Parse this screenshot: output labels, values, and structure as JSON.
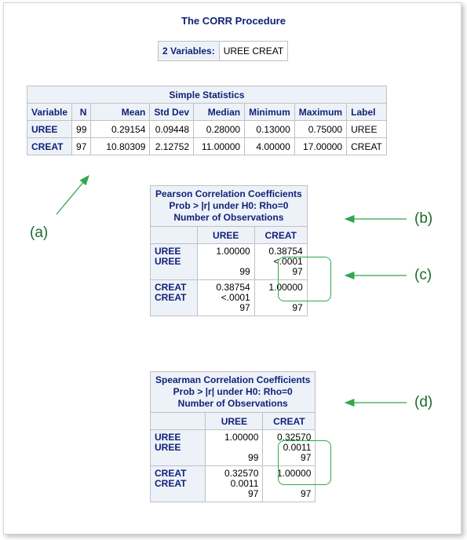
{
  "title": "The CORR Procedure",
  "variables_box": {
    "label": "2 Variables:",
    "value": "UREE CREAT"
  },
  "simple_stats": {
    "caption": "Simple Statistics",
    "headers": [
      "Variable",
      "N",
      "Mean",
      "Std Dev",
      "Median",
      "Minimum",
      "Maximum",
      "Label"
    ],
    "rows": [
      [
        "UREE",
        "99",
        "0.29154",
        "0.09448",
        "0.28000",
        "0.13000",
        "0.75000",
        "UREE"
      ],
      [
        "CREAT",
        "97",
        "10.80309",
        "2.12752",
        "11.00000",
        "4.00000",
        "17.00000",
        "CREAT"
      ]
    ]
  },
  "pearson": {
    "caption": [
      "Pearson Correlation Coefficients",
      "Prob > |r| under H0: Rho=0",
      "Number of Observations"
    ],
    "col_headers": [
      "UREE",
      "CREAT"
    ],
    "rows": [
      {
        "name": "UREE",
        "label": "UREE",
        "c1": [
          "1.00000",
          "",
          "99"
        ],
        "c2": [
          "0.38754",
          "<.0001",
          "97"
        ]
      },
      {
        "name": "CREAT",
        "label": "CREAT",
        "c1": [
          "0.38754",
          "<.0001",
          "97"
        ],
        "c2": [
          "1.00000",
          "",
          "97"
        ]
      }
    ]
  },
  "spearman": {
    "caption": [
      "Spearman Correlation Coefficients",
      "Prob > |r| under H0: Rho=0",
      "Number of Observations"
    ],
    "col_headers": [
      "UREE",
      "CREAT"
    ],
    "rows": [
      {
        "name": "UREE",
        "label": "UREE",
        "c1": [
          "1.00000",
          "",
          "99"
        ],
        "c2": [
          "0.32570",
          "0.0011",
          "97"
        ]
      },
      {
        "name": "CREAT",
        "label": "CREAT",
        "c1": [
          "0.32570",
          "0.0011",
          "97"
        ],
        "c2": [
          "1.00000",
          "",
          "97"
        ]
      }
    ]
  },
  "annotations": {
    "a": "(a)",
    "b": "(b)",
    "c": "(c)",
    "d": "(d)"
  },
  "colors": {
    "header_text": "#112277",
    "header_bg": "#edf2f9",
    "annotation": "#2fa84f"
  }
}
